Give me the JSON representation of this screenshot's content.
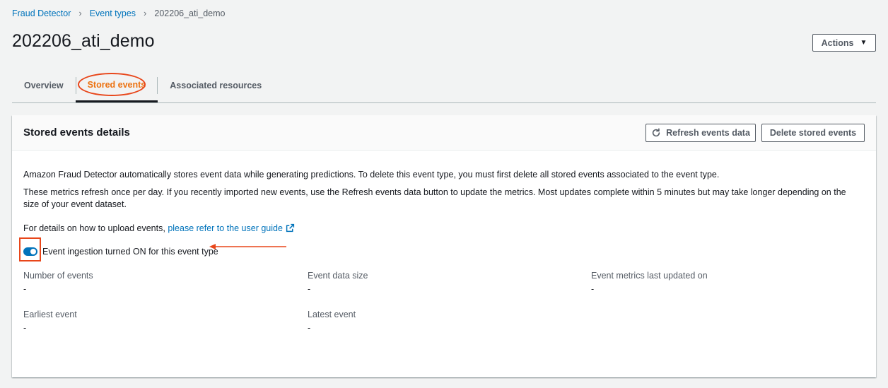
{
  "breadcrumb": {
    "items": [
      "Fraud Detector",
      "Event types"
    ],
    "current": "202206_ati_demo"
  },
  "page": {
    "title": "202206_ati_demo",
    "actions_label": "Actions"
  },
  "tabs": [
    {
      "label": "Overview"
    },
    {
      "label": "Stored events",
      "active": true
    },
    {
      "label": "Associated resources"
    }
  ],
  "panel": {
    "title": "Stored events details",
    "refresh_label": "Refresh events data",
    "delete_label": "Delete stored events",
    "description1": "Amazon Fraud Detector automatically stores event data while generating predictions. To delete this event type, you must first delete all stored events associated to the event type.",
    "description2": "These metrics refresh once per day. If you recently imported new events, use the Refresh events data button to update the metrics. Most updates complete within 5 minutes but may take longer depending on the size of your event dataset.",
    "upload_prefix": "For details on how to upload events,",
    "upload_link": "please refer to the user guide",
    "toggle_label": "Event ingestion turned ON for this event type",
    "toggle_on": true
  },
  "metrics": {
    "number_of_events": {
      "label": "Number of events",
      "value": "-"
    },
    "event_data_size": {
      "label": "Event data size",
      "value": "-"
    },
    "last_updated": {
      "label": "Event metrics last updated on",
      "value": "-"
    },
    "earliest_event": {
      "label": "Earliest event",
      "value": "-"
    },
    "latest_event": {
      "label": "Latest event",
      "value": "-"
    }
  },
  "colors": {
    "accent": "#ec7211",
    "link": "#0073bb",
    "annotation": "#e8461a"
  }
}
